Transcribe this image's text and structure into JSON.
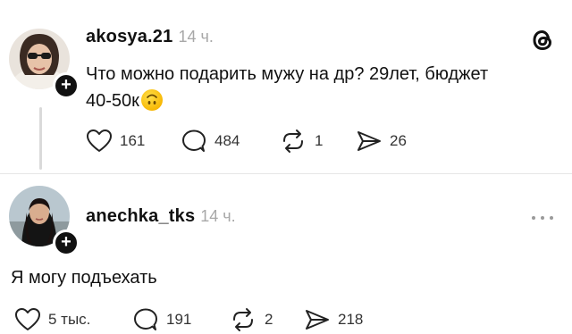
{
  "post": {
    "username": "akosya.21",
    "time": "14 ч.",
    "text_line1": "Что можно подарить мужу на др? 29лет, бюджет",
    "text_line2": "40-50к",
    "emoji": "upside-down face",
    "likes": "161",
    "comments": "484",
    "reposts": "1",
    "shares": "26"
  },
  "reply": {
    "username": "anechka_tks",
    "time": "14 ч.",
    "text": "Я могу подъехать",
    "likes": "5 тыс.",
    "comments": "191",
    "reposts": "2",
    "shares": "218"
  },
  "icons": {
    "app_logo": "threads-logo-icon",
    "more": "more-dots-icon",
    "like": "heart-icon",
    "comment": "comment-bubble-icon",
    "repost": "repost-icon",
    "share": "send-icon",
    "follow": "plus-icon"
  }
}
